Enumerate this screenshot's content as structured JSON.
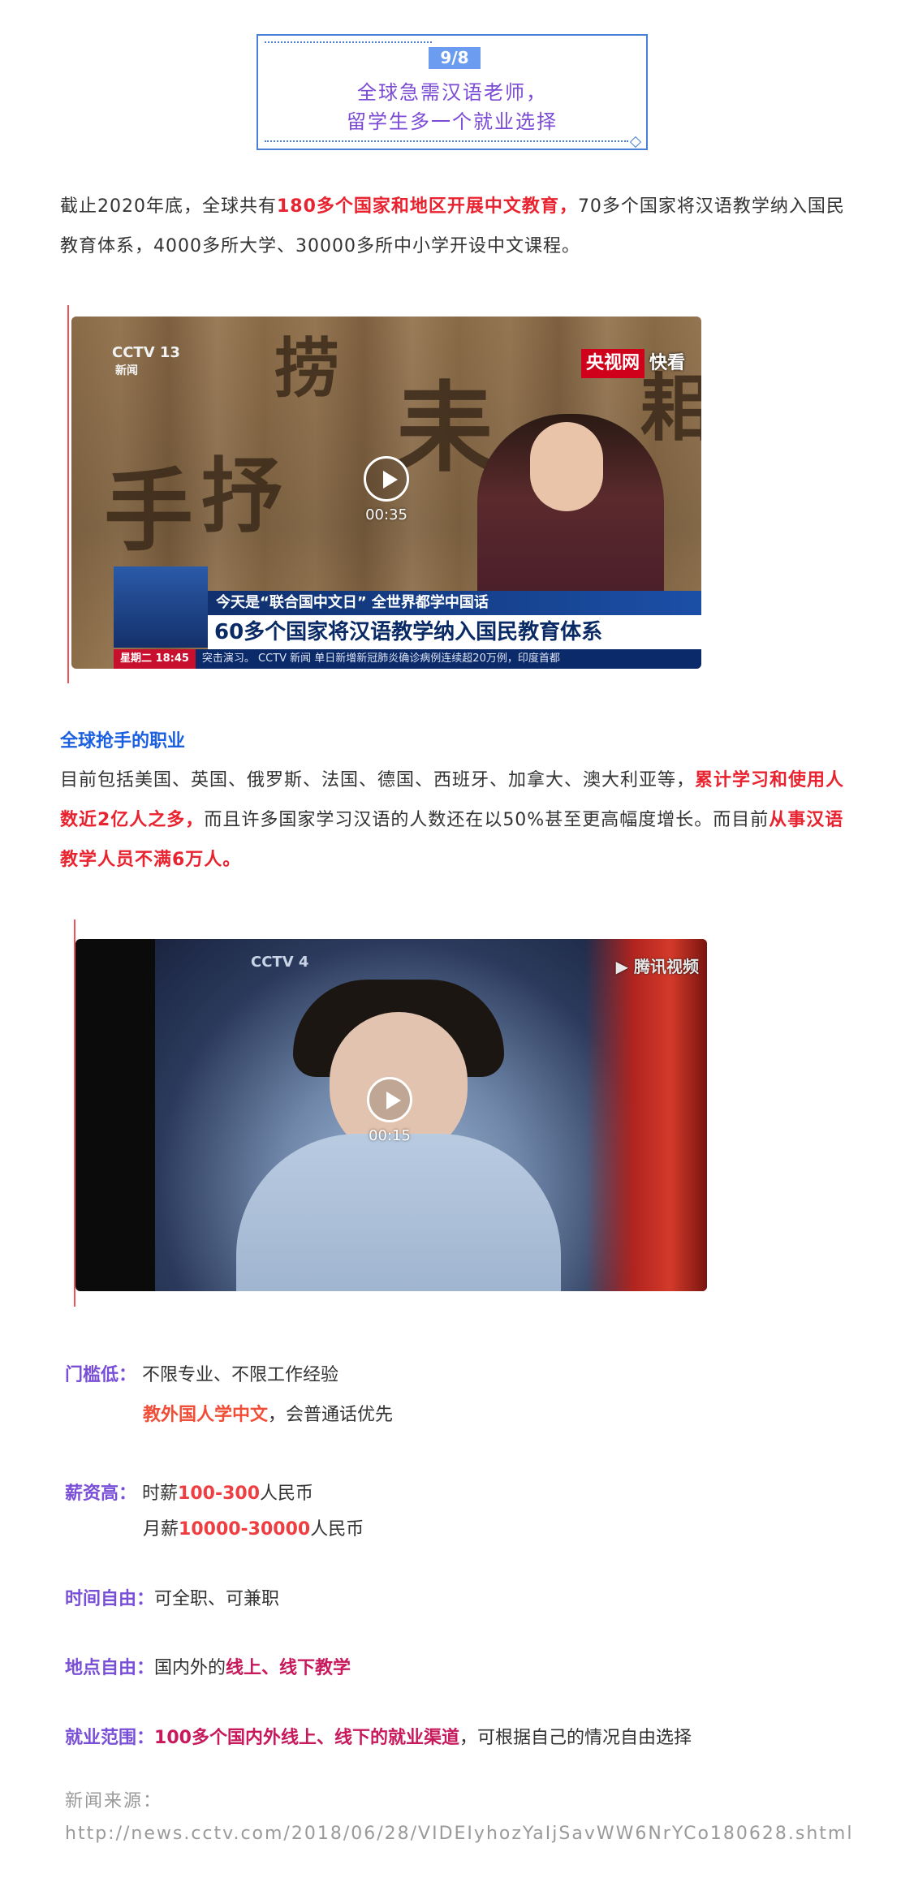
{
  "header": {
    "badge": "9/8",
    "title_line1": "全球急需汉语老师，",
    "title_line2": "留学生多一个就业选择"
  },
  "intro": {
    "p1_a": "截止2020年底，全球共有",
    "p1_b": "180多个国家和地区开展中文教育，",
    "p1_c": "70多个国家将汉语教学纳入国民教育体系，4000多所大学、30000多所中小学开设中文课程。"
  },
  "video1": {
    "channel": "CCTV 13",
    "channel_sub": "新闻",
    "brand_red": "央视网",
    "brand_white": "快看",
    "strip_top": "今天是“联合国中文日” 全世界都学中国话",
    "strip_main": "60多个国家将汉语教学纳入国民教育体系",
    "ticker_time": "星期二 18:45",
    "ticker_text": "突击演习。  CCTV 新闻  单日新增新冠肺炎确诊病例连续超20万例，印度首都",
    "duration": "00:35",
    "char1": "捞",
    "char2": "耒",
    "char3": "抒",
    "char4": "手",
    "char5": "耜"
  },
  "section": {
    "heading": "全球抢手的职业",
    "p2_a": "目前包括美国、英国、俄罗斯、法国、德国、西班牙、加拿大、澳大利亚等，",
    "p2_b": "累计学习和使用人数近2亿人之多，",
    "p2_c": "而且许多国家学习汉语的人数还在以50%甚至更高幅度增长。而目前",
    "p2_d": "从事汉语教学人员不满6万人。"
  },
  "video2": {
    "channel": "CCTV 4",
    "watermark": "腾讯视频",
    "duration": "00:15"
  },
  "info": {
    "threshold_label": "门槛低：",
    "threshold_text": "不限专业、不限工作经验",
    "threshold_hl": "教外国人学中文",
    "threshold_rest": "，会普通话优先",
    "salary_label": "薪资高：",
    "salary_hour_a": "时薪",
    "salary_hour_val": "100-300",
    "salary_hour_unit": "人民币",
    "salary_month_a": "月薪",
    "salary_month_val": "10000-30000",
    "salary_month_unit": "人民币",
    "time_label": "时间自由：",
    "time_text": "可全职、可兼职",
    "place_label": "地点自由：",
    "place_text": "国内外的",
    "place_hl": "线上、线下教学",
    "scope_label": "就业范围：",
    "scope_hl": "100多个国内外线上、线下的就业渠道",
    "scope_rest": "，可根据自己的情况自由选择"
  },
  "source": {
    "label": "新闻来源：",
    "url": "http://news.cctv.com/2018/06/28/VIDEIyhozYaIjSavWW6NrYCo180628.shtml"
  },
  "colors": {
    "accent_blue": "#4a7fd6",
    "purple_label": "#7a4fd8",
    "highlight_red": "#e8232f"
  }
}
